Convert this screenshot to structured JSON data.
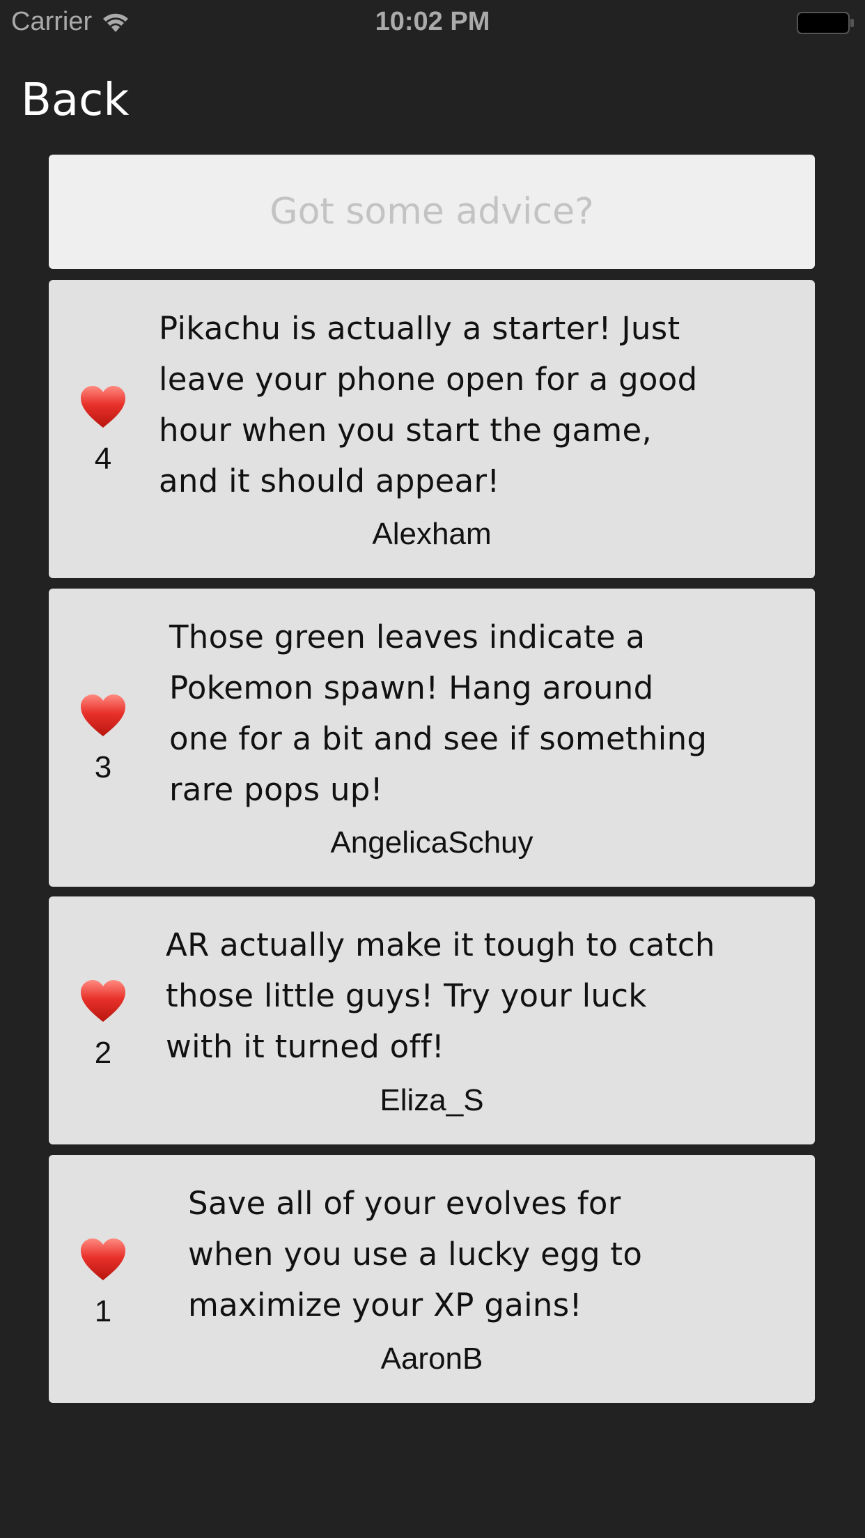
{
  "status_bar": {
    "carrier": "Carrier",
    "time": "10:02 PM",
    "wifi_icon": "wifi-icon",
    "battery_icon": "battery-icon"
  },
  "nav": {
    "back_label": "Back"
  },
  "composer": {
    "placeholder": "Got some advice?"
  },
  "colors": {
    "background": "#222222",
    "card": "#e1e1e1",
    "input": "#efefef",
    "heart": "#e8312a"
  },
  "tips": [
    {
      "likes": "4",
      "icon": "heart-icon",
      "text": "Pikachu is actually a starter! Just leave your phone open for a good hour when you start the game, and it should appear!",
      "author": "Alexham"
    },
    {
      "likes": "3",
      "icon": "heart-icon",
      "text": "Those green leaves indicate a Pokemon spawn! Hang around one for a bit and see if something rare pops up!",
      "author": "AngelicaSchuy"
    },
    {
      "likes": "2",
      "icon": "heart-icon",
      "text": "AR actually make it tough to catch those little guys! Try your luck with it turned off!",
      "author": "Eliza_S"
    },
    {
      "likes": "1",
      "icon": "heart-icon",
      "text": "Save all of your evolves for when you use a lucky egg to maximize your XP gains!",
      "author": "AaronB"
    }
  ]
}
